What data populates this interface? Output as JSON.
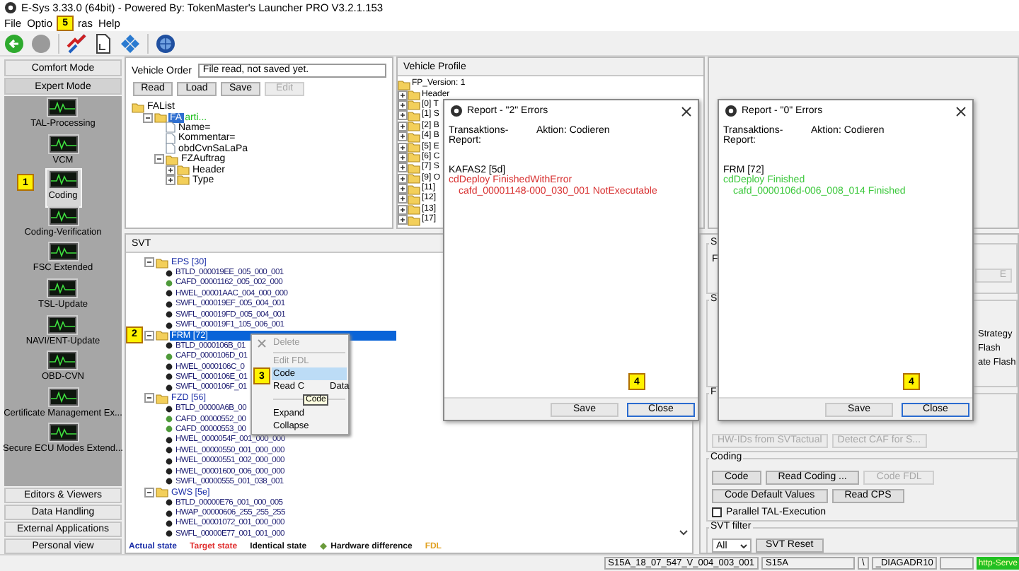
{
  "window": {
    "title": "E-Sys 3.33.0  (64bit) - Powered By: TokenMaster's Launcher PRO V3.2.1.153"
  },
  "menu": [
    {
      "kind": "item",
      "label": "File"
    },
    {
      "kind": "item",
      "label": "Optio"
    },
    {
      "kind": "badge",
      "label": "5"
    },
    {
      "kind": "item",
      "label": "ras"
    },
    {
      "kind": "item",
      "label": "Help"
    }
  ],
  "sidebar": {
    "modes": [
      {
        "label": "Comfort Mode",
        "selected": false
      },
      {
        "label": "Expert Mode",
        "selected": true
      }
    ],
    "items": [
      {
        "label": "TAL-Processing",
        "selected": false
      },
      {
        "label": "VCM",
        "selected": false
      },
      {
        "label": "Coding",
        "selected": true,
        "badge": "1"
      },
      {
        "label": "Coding-Verification",
        "selected": false
      },
      {
        "label": "FSC Extended",
        "selected": false
      },
      {
        "label": "TSL-Update",
        "selected": false
      },
      {
        "label": "NAVI/ENT-Update",
        "selected": false
      },
      {
        "label": "OBD-CVN",
        "selected": false
      },
      {
        "label": "Certificate Management Ex...",
        "selected": false
      },
      {
        "label": "Secure ECU Modes Extend...",
        "selected": false
      }
    ],
    "sections": [
      "Editors & Viewers",
      "Data Handling",
      "External Applications",
      "Personal view"
    ]
  },
  "vehicle_order": {
    "label": "Vehicle Order",
    "field": "File read, not saved yet.",
    "buttons": [
      {
        "label": "Read",
        "disabled": false
      },
      {
        "label": "Load",
        "disabled": false
      },
      {
        "label": "Save",
        "disabled": false
      },
      {
        "label": "Edit",
        "disabled": true
      }
    ],
    "tree": [
      {
        "kind": "folder",
        "label": "FAList",
        "selected": false,
        "children": [
          {
            "kind": "folder",
            "label": "FA",
            "note": "arti...",
            "selected": true,
            "expanded": true,
            "children": [
              {
                "kind": "item",
                "label": "Name=",
                "selected": false
              },
              {
                "kind": "item",
                "label": "Kommentar=",
                "selected": false
              },
              {
                "kind": "item",
                "label": "obdCvnSaLaPa",
                "selected": false
              },
              {
                "kind": "folder",
                "label": "FZAuftrag",
                "selected": false,
                "expanded": true,
                "children": [
                  {
                    "kind": "folder",
                    "label": "Header",
                    "selected": false,
                    "expanded": false
                  },
                  {
                    "kind": "folder",
                    "label": "Type",
                    "selected": false,
                    "expanded": false
                  }
                ]
              }
            ]
          }
        ]
      }
    ]
  },
  "vehicle_profile": {
    "title": "Vehicle Profile",
    "tree": [
      {
        "kind": "folder",
        "label": "FP_Version: 1",
        "children": [
          {
            "kind": "folder",
            "label": "Header",
            "expanded": false
          },
          {
            "kind": "folder",
            "label": "[0] T",
            "expanded": false
          },
          {
            "kind": "folder",
            "label": "[1] S",
            "expanded": false
          },
          {
            "kind": "folder",
            "label": "[2] B",
            "expanded": false
          },
          {
            "kind": "folder",
            "label": "[4] B",
            "expanded": false
          },
          {
            "kind": "folder",
            "label": "[5] E",
            "expanded": false
          },
          {
            "kind": "folder",
            "label": "[6] C",
            "expanded": false
          },
          {
            "kind": "folder",
            "label": "[7] S",
            "expanded": false
          },
          {
            "kind": "folder",
            "label": "[9] O",
            "expanded": false
          },
          {
            "kind": "folder",
            "label": "[11]",
            "expanded": false
          },
          {
            "kind": "folder",
            "label": "[12]",
            "expanded": false
          },
          {
            "kind": "folder",
            "label": "[13]",
            "expanded": false
          },
          {
            "kind": "folder",
            "label": "[17]",
            "expanded": false
          }
        ]
      }
    ]
  },
  "svt": {
    "title": "SVT",
    "ecus": [
      {
        "label": "EPS [30]",
        "expanded": true,
        "selected": false,
        "children": [
          {
            "label": "BTLD_000019EE_005_000_001",
            "color": "#222222",
            "selected": false
          },
          {
            "label": "CAFD_00001162_005_002_000",
            "color": "#4e9a3a",
            "selected": false
          },
          {
            "label": "HWEL_00001AAC_004_000_000",
            "color": "#222222",
            "selected": false
          },
          {
            "label": "SWFL_000019EF_005_004_001",
            "color": "#222222",
            "selected": false
          },
          {
            "label": "SWFL_000019FD_005_004_001",
            "color": "#222222",
            "selected": false
          },
          {
            "label": "SWFL_000019F1_105_006_001",
            "color": "#222222",
            "selected": false
          }
        ]
      },
      {
        "label": "FRM [72]",
        "expanded": true,
        "selected": true,
        "badge": "2",
        "children": [
          {
            "label": "BTLD_0000106B_01",
            "color": "#222222",
            "selected": false
          },
          {
            "label": "CAFD_0000106D_01",
            "color": "#4e9a3a",
            "selected": false
          },
          {
            "label": "HWEL_0000106C_0",
            "color": "#222222",
            "selected": false
          },
          {
            "label": "SWFL_0000106E_01",
            "color": "#222222",
            "selected": false
          },
          {
            "label": "SWFL_0000106F_01",
            "color": "#222222",
            "selected": false
          }
        ]
      },
      {
        "label": "FZD [56]",
        "expanded": true,
        "selected": false,
        "children": [
          {
            "label": "BTLD_00000A6B_00",
            "color": "#222222",
            "selected": false
          },
          {
            "label": "CAFD_00000552_00",
            "color": "#4e9a3a",
            "selected": false
          },
          {
            "label": "CAFD_00000553_00",
            "color": "#4e9a3a",
            "selected": false
          },
          {
            "label": "HWEL_0000054F_001_000_000",
            "color": "#222222",
            "selected": false
          },
          {
            "label": "HWEL_00000550_001_000_000",
            "color": "#222222",
            "selected": false
          },
          {
            "label": "HWEL_00000551_002_000_000",
            "color": "#222222",
            "selected": false
          },
          {
            "label": "HWEL_00001600_006_000_000",
            "color": "#222222",
            "selected": false
          },
          {
            "label": "SWFL_00000555_001_038_001",
            "color": "#222222",
            "selected": false
          }
        ]
      },
      {
        "label": "GWS [5e]",
        "expanded": true,
        "selected": false,
        "children": [
          {
            "label": "BTLD_00000E76_001_000_005",
            "color": "#222222",
            "selected": false
          },
          {
            "label": "HWAP_00000606_255_255_255",
            "color": "#222222",
            "selected": false
          },
          {
            "label": "HWEL_00001072_001_000_000",
            "color": "#222222",
            "selected": false
          },
          {
            "label": "SWFL_00000E77_001_001_000",
            "color": "#222222",
            "selected": false
          }
        ]
      }
    ],
    "context_menu": {
      "items": [
        {
          "kind": "delete",
          "label": "Delete",
          "disabled": true,
          "selected": false
        },
        {
          "kind": "separator"
        },
        {
          "kind": "item",
          "label": "Edit FDL",
          "disabled": true,
          "selected": false
        },
        {
          "kind": "item",
          "label": "Code",
          "disabled": false,
          "selected": true,
          "badge": "3"
        },
        {
          "kind": "split",
          "label": "Read C",
          "label_end": "Data",
          "disabled": false,
          "selected": false
        },
        {
          "kind": "separator"
        },
        {
          "kind": "item",
          "label": "Expand",
          "disabled": false,
          "selected": false
        },
        {
          "kind": "item",
          "label": "Collapse",
          "disabled": false,
          "selected": false
        }
      ],
      "tooltip": "Code"
    },
    "legend": [
      {
        "kind": "text",
        "label": "Actual state",
        "color": "#1c2fa8"
      },
      {
        "kind": "text",
        "label": "Target state",
        "color": "#e03030"
      },
      {
        "kind": "text",
        "label": "Identical state",
        "color": "#101010"
      },
      {
        "kind": "icon",
        "label": "Hardware difference",
        "color": "#101010"
      },
      {
        "kind": "text",
        "label": "FDL",
        "color": "#e0a020"
      }
    ]
  },
  "right_panel": {
    "groups": [
      {
        "label": "S",
        "row_label": "F",
        "button": "E"
      },
      {
        "label": "S",
        "options": [
          "Strategy",
          "Flash",
          "ate Flash"
        ]
      },
      {
        "label": "F",
        "buttons": [
          {
            "label": "HW-IDs from SVTactual",
            "disabled": true
          },
          {
            "label": "Detect CAF for S...",
            "disabled": true
          }
        ]
      }
    ],
    "coding": {
      "title": "Coding",
      "rows": [
        [
          {
            "label": "Code",
            "disabled": false
          },
          {
            "label": "Read Coding ...",
            "disabled": false
          },
          {
            "label": "Code FDL",
            "disabled": true
          }
        ],
        [
          {
            "label": "Code Default Values",
            "disabled": false
          },
          {
            "label": "Read CPS",
            "disabled": false
          }
        ]
      ],
      "checkbox": {
        "label": "Parallel TAL-Execution",
        "checked": false
      }
    },
    "svt_filter": {
      "title": "SVT filter",
      "select": "All",
      "button": "SVT Reset"
    }
  },
  "reports": [
    {
      "title": "Report - \"2\" Errors",
      "header": "Transaktions-Report:",
      "action": "Aktion: Codieren",
      "badge": "4",
      "lines": [
        {
          "kind": "ecu",
          "text": "KAFAS2 [5d]",
          "color": "#000000"
        },
        {
          "kind": "status",
          "text": "cdDeploy FinishedWithError",
          "color": "#d83030"
        },
        {
          "kind": "detail",
          "text": "cafd_00001148-000_030_001 NotExecutable",
          "color": "#d83030"
        }
      ],
      "buttons": [
        {
          "label": "Save",
          "focused": false
        },
        {
          "label": "Close",
          "focused": true
        }
      ]
    },
    {
      "title": "Report - \"0\" Errors",
      "header": "Transaktions-Report:",
      "action": "Aktion: Codieren",
      "badge": "4",
      "lines": [
        {
          "kind": "ecu",
          "text": "FRM [72]",
          "color": "#000000"
        },
        {
          "kind": "status",
          "text": "cdDeploy Finished",
          "color": "#3cc83c"
        },
        {
          "kind": "detail",
          "text": "cafd_0000106d-006_008_014 Finished",
          "color": "#3cc83c"
        }
      ],
      "buttons": [
        {
          "label": "Save",
          "focused": false
        },
        {
          "label": "Close",
          "focused": true
        }
      ]
    }
  ],
  "status_bar": {
    "cells": [
      "S15A_18_07_547_V_004_003_001",
      "S15A",
      "\\",
      "_DIAGADR10"
    ],
    "server": {
      "label": "http-Serve",
      "on": true
    }
  }
}
